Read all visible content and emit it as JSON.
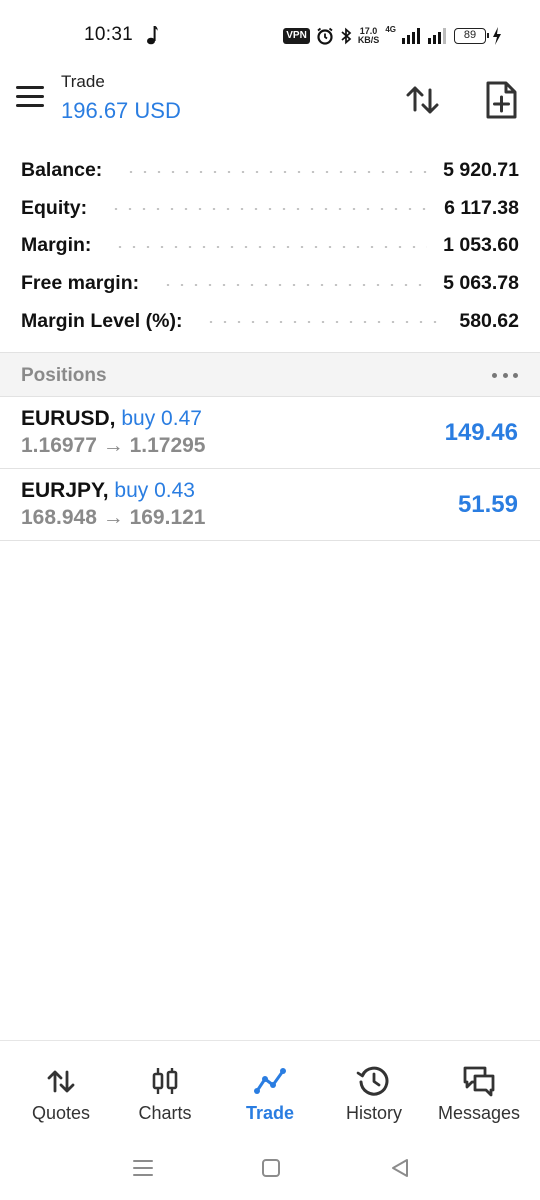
{
  "status_bar": {
    "time": "10:31",
    "vpn": "VPN",
    "speed_value": "17.0",
    "speed_unit": "KB/S",
    "network": "4G",
    "battery": "89"
  },
  "header": {
    "title": "Trade",
    "balance": "196.67 USD"
  },
  "summary": [
    {
      "label": "Balance:",
      "value": "5 920.71"
    },
    {
      "label": "Equity:",
      "value": "6 117.38"
    },
    {
      "label": "Margin:",
      "value": "1 053.60"
    },
    {
      "label": "Free margin:",
      "value": "5 063.78"
    },
    {
      "label": "Margin Level (%):",
      "value": "580.62"
    }
  ],
  "positions": {
    "title": "Positions",
    "items": [
      {
        "symbol": "EURUSD,",
        "direction": "buy 0.47",
        "prices": "1.16977 → 1.17295",
        "profit": "149.46"
      },
      {
        "symbol": "EURJPY,",
        "direction": "buy 0.43",
        "prices": "168.948 → 169.121",
        "profit": "51.59"
      }
    ]
  },
  "nav": {
    "quotes": "Quotes",
    "charts": "Charts",
    "trade": "Trade",
    "history": "History",
    "messages": "Messages",
    "active": "trade"
  },
  "colors": {
    "accent": "#2a7de1",
    "muted": "#8a8a8a"
  }
}
